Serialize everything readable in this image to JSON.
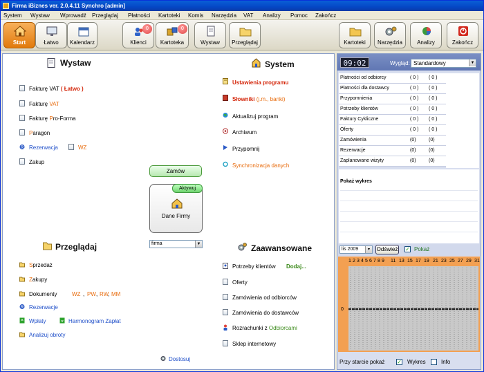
{
  "window": {
    "title": "Firma iBiznes ver. 2.0.4.11  Synchro  [admin]"
  },
  "menu": [
    "System",
    "Wystaw",
    "Wprowadź",
    "Przeglądaj",
    "Płatności",
    "Kartoteki",
    "Komis",
    "Narzędzia",
    "VAT",
    "Analizy",
    "Pomoc",
    "Zakończ"
  ],
  "toolbar": {
    "start": "Start",
    "latwo": "Łatwo",
    "kalendarz": "Kalendarz",
    "klienci": "Klienci",
    "klienci_badge": "0",
    "kartoteka": "Kartoteka",
    "kartoteka_badge": "0",
    "wystaw": "Wystaw",
    "przegladaj": "Przeglądaj",
    "kartoteki": "Kartoteki",
    "narzedzia": "Narzędzia",
    "analizy": "Analizy",
    "zakoncz": "Zakończ"
  },
  "wystaw": {
    "title": "Wystaw",
    "faktura_vat": "Fakturę VAT",
    "latwo": "( Łatwo )",
    "faktura_vat2_a": "Fakturę ",
    "faktura_vat2_b": "VAT",
    "proforma_a": "Fakturę ",
    "proforma_b": "P",
    "proforma_c": "ro-Forma",
    "paragon_a": "P",
    "paragon_b": "aragon",
    "rezerwacja": "Rezerwacja",
    "wz": "WZ",
    "zakup": "Zakup"
  },
  "system": {
    "title": "System",
    "ustawienia": "Ustawienia programu",
    "slowniki": "Słowniki",
    "slowniki_note": "(j.m., banki)",
    "aktualizuj": "Aktualizuj program",
    "archiwum": "Archiwum",
    "przypomnij": "Przypomnij",
    "synchronizacja": "Synchronizacja danych"
  },
  "center": {
    "zamow": "Zamów",
    "aktywuj": "Aktywuj",
    "dane_firmy": "Dane Firmy",
    "firma_select": "firma"
  },
  "przegladaj": {
    "title": "Przeglądaj",
    "sprzedaz_a": "S",
    "sprzedaz_b": "przedaż",
    "zakupy_a": "Z",
    "zakupy_b": "akupy",
    "dokumenty": "Dokumenty",
    "dok_wz": "WZ",
    "dok_pw": "PW",
    "dok_rw": "RW",
    "dok_mm": "MM",
    "rezerwacje": "Rezerwacje",
    "wplaty": "Wpłaty",
    "harmonogram": "Harmonogram Zapłat",
    "analizuj": "Analizuj obroty"
  },
  "zaawansowane": {
    "title": "Zaawansowane",
    "potrzeby": "Potrzeby klientów",
    "dodaj": "Dodaj...",
    "oferty": "Oferty",
    "zam_od": "Zamówienia od odbiorców",
    "zam_do": "Zamówienia do dostawców",
    "rozrachunki_a": "Rozrachunki z ",
    "rozrachunki_b": "Odbiorcami",
    "sklep": "Sklep internetowy"
  },
  "dostosuj": "Dostosuj",
  "right": {
    "clock": "09:02",
    "wyglad_label": "Wygląd:",
    "wyglad_value": "Standardowy",
    "stats": [
      {
        "name": "Płatności od odbiorcy",
        "c1": "( 0 )",
        "c2": "( 0 )"
      },
      {
        "name": "Płatności dla dostawcy",
        "c1": "( 0 )",
        "c2": "( 0 )"
      },
      {
        "name": "Przypomnienia",
        "c1": "( 0 )",
        "c2": "( 0 )"
      },
      {
        "name": "Potrzeby klientów",
        "c1": "( 0 )",
        "c2": "( 0 )"
      },
      {
        "name": "Faktury Cykliczne",
        "c1": "( 0 )",
        "c2": "( 0 )"
      },
      {
        "name": "Oferty",
        "c1": "( 0 )",
        "c2": "( 0 )"
      },
      {
        "name": "Zamówienia",
        "c1": "(0)",
        "c2": "(0)"
      },
      {
        "name": "Rezerwacje",
        "c1": "(0)",
        "c2": "(0)"
      },
      {
        "name": "Zaplanowane wizyty",
        "c1": "(0)",
        "c2": "(0)"
      }
    ],
    "pokaz_wykres": "Pokaż wykres",
    "month_year": "lis  2009",
    "odswiez": "Odśwież",
    "pokaz": "Pokaż",
    "chart_zero": "0",
    "days": [
      "1",
      "2",
      "3",
      "4",
      "5",
      "6",
      "7",
      "8",
      "9",
      "11",
      "13",
      "15",
      "17",
      "19",
      "21",
      "23",
      "25",
      "27",
      "29",
      "31"
    ],
    "przy_starcie": "Przy starcie pokaż",
    "wykres": "Wykres",
    "info": "Info"
  },
  "colors": {
    "accent_orange": "#e86a0a",
    "title_blue": "#0447c5",
    "link_blue": "#1f4fc9",
    "panel_blue": "#d8deef"
  }
}
